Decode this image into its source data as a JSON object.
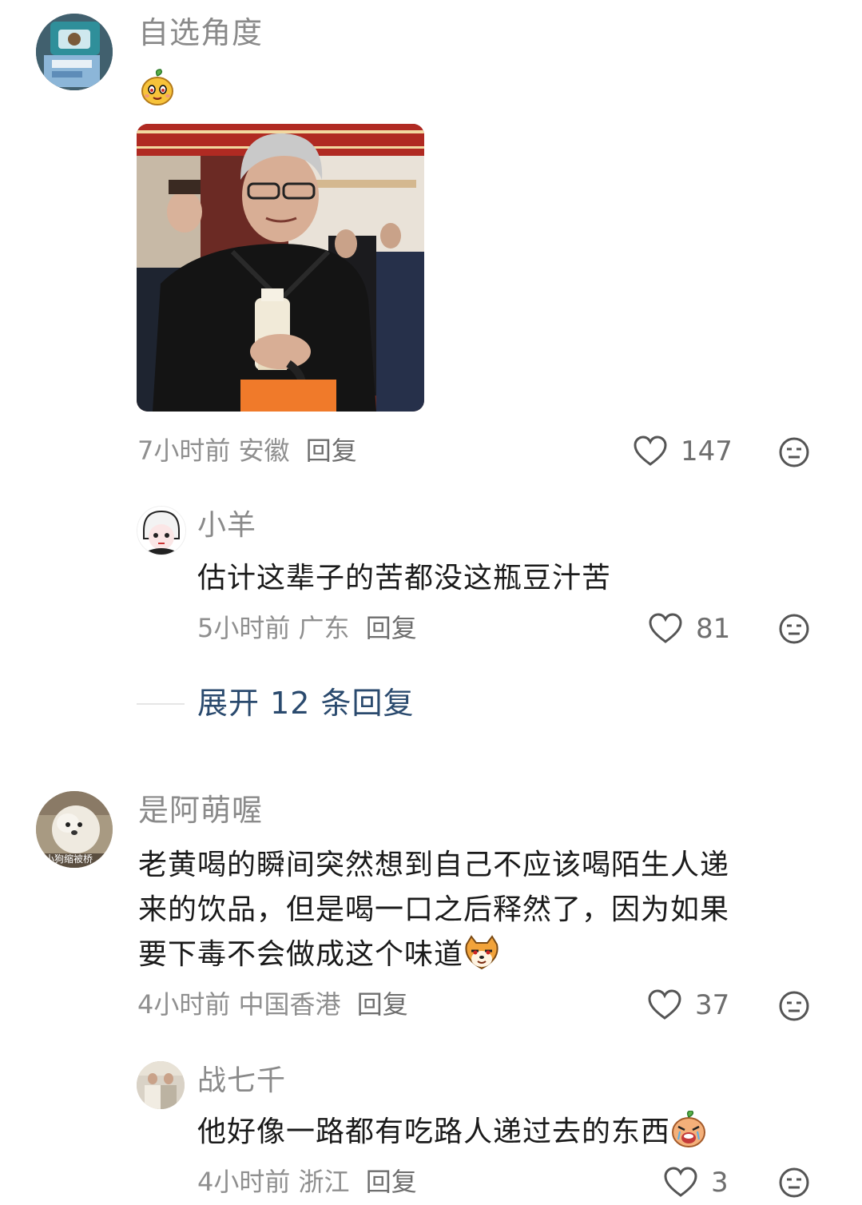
{
  "comments": [
    {
      "username": "自选角度",
      "time": "7小时前",
      "location": "安徽",
      "reply_label": "回复",
      "likes": "147",
      "emoji_icon": "mango-face-sticker-icon",
      "image_icon": "photo-man-holding-bottle-icon"
    },
    {
      "username": "是阿萌喔",
      "text_line1": "老黄喝的瞬间突然想到自己不应该喝陌生人递",
      "text_line2": "来的饮品，但是喝一口之后释然了，因为如果",
      "text_line3": "要下毒不会做成这个味道",
      "time": "4小时前",
      "location": "中国香港",
      "reply_label": "回复",
      "likes": "37",
      "avatar_text": "小狗缩被桥",
      "emoji_icon": "shiba-smirk-sticker-icon"
    }
  ],
  "replies": [
    {
      "username": "小羊",
      "text": "估计这辈子的苦都没这瓶豆汁苦",
      "time": "5小时前",
      "location": "广东",
      "reply_label": "回复",
      "likes": "81"
    },
    {
      "username": "战七千",
      "text": "他好像一路都有吃路人递过去的东西",
      "time": "4小时前",
      "location": "浙江",
      "reply_label": "回复",
      "likes": "3",
      "emoji_icon": "crying-mango-sticker-icon"
    }
  ],
  "expand_label": "展开 12 条回复",
  "colors": {
    "expand_link": "#2a4a6e",
    "meta": "#8f8f8f",
    "username": "#8a8a8a"
  }
}
